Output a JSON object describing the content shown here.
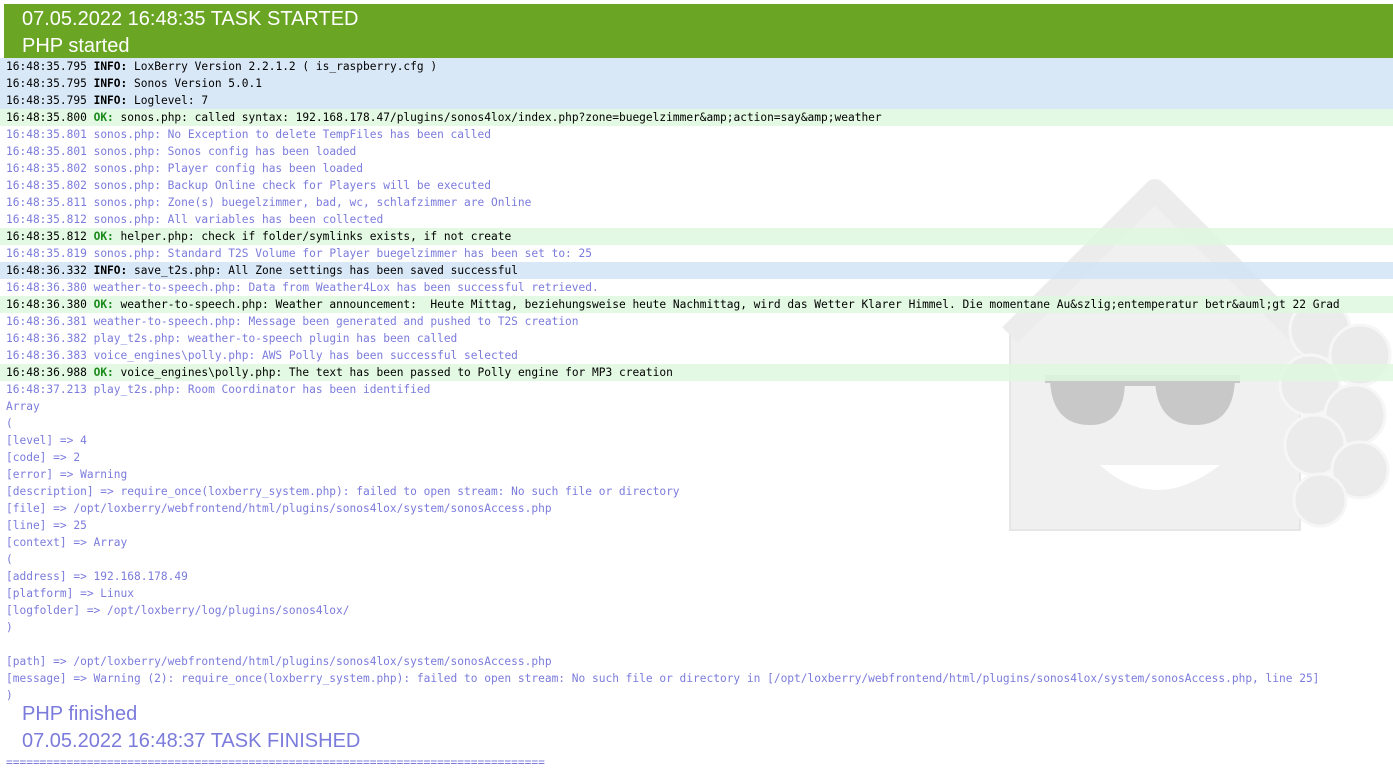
{
  "header": {
    "task_started": "07.05.2022 16:48:35 TASK STARTED",
    "php_started": "PHP started"
  },
  "log_lines": [
    {
      "type": "info",
      "ts": "16:48:35.795",
      "level": "INFO:",
      "msg": "LoxBerry Version 2.2.1.2 ( is_raspberry.cfg )"
    },
    {
      "type": "info",
      "ts": "16:48:35.795",
      "level": "INFO:",
      "msg": "Sonos Version 5.0.1"
    },
    {
      "type": "info",
      "ts": "16:48:35.795",
      "level": "INFO:",
      "msg": "Loglevel: 7"
    },
    {
      "type": "ok",
      "ts": "16:48:35.800",
      "level": "OK:",
      "msg": "sonos.php: called syntax: 192.168.178.47/plugins/sonos4lox/index.php?zone=buegelzimmer&amp;action=say&amp;weather"
    },
    {
      "type": "debug",
      "ts": "16:48:35.801",
      "level": "",
      "msg": "sonos.php: No Exception to delete TempFiles has been called"
    },
    {
      "type": "debug",
      "ts": "16:48:35.801",
      "level": "",
      "msg": "sonos.php: Sonos config has been loaded"
    },
    {
      "type": "debug",
      "ts": "16:48:35.802",
      "level": "",
      "msg": "sonos.php: Player config has been loaded"
    },
    {
      "type": "debug",
      "ts": "16:48:35.802",
      "level": "",
      "msg": "sonos.php: Backup Online check for Players will be executed"
    },
    {
      "type": "debug",
      "ts": "16:48:35.811",
      "level": "",
      "msg": "sonos.php: Zone(s) buegelzimmer, bad, wc, schlafzimmer are Online"
    },
    {
      "type": "debug",
      "ts": "16:48:35.812",
      "level": "",
      "msg": "sonos.php: All variables has been collected"
    },
    {
      "type": "ok",
      "ts": "16:48:35.812",
      "level": "OK:",
      "msg": "helper.php: check if folder/symlinks exists, if not create"
    },
    {
      "type": "debug",
      "ts": "16:48:35.819",
      "level": "",
      "msg": "sonos.php: Standard T2S Volume for Player buegelzimmer has been set to: 25"
    },
    {
      "type": "info",
      "ts": "16:48:36.332",
      "level": "INFO:",
      "msg": "save_t2s.php: All Zone settings has been saved successful"
    },
    {
      "type": "debug",
      "ts": "16:48:36.380",
      "level": "",
      "msg": "weather-to-speech.php: Data from Weather4Lox has been successful retrieved."
    },
    {
      "type": "ok",
      "ts": "16:48:36.380",
      "level": "OK:",
      "msg": "weather-to-speech.php: Weather announcement:  Heute Mittag, beziehungsweise heute Nachmittag, wird das Wetter Klarer Himmel. Die momentane Au&szlig;entemperatur betr&auml;gt 22 Grad"
    },
    {
      "type": "debug",
      "ts": "16:48:36.381",
      "level": "",
      "msg": "weather-to-speech.php: Message been generated and pushed to T2S creation"
    },
    {
      "type": "debug",
      "ts": "16:48:36.382",
      "level": "",
      "msg": "play_t2s.php: weather-to-speech plugin has been called"
    },
    {
      "type": "debug",
      "ts": "16:48:36.383",
      "level": "",
      "msg": "voice_engines\\polly.php: AWS Polly has been successful selected"
    },
    {
      "type": "ok",
      "ts": "16:48:36.988",
      "level": "OK:",
      "msg": "voice_engines\\polly.php: The text has been passed to Polly engine for MP3 creation"
    },
    {
      "type": "debug",
      "ts": "16:48:37.213",
      "level": "",
      "msg": "play_t2s.php: Room Coordinator has been identified"
    },
    {
      "type": "plain",
      "ts": "",
      "level": "",
      "msg": "Array"
    },
    {
      "type": "plain",
      "ts": "",
      "level": "",
      "msg": "("
    },
    {
      "type": "plain",
      "ts": "",
      "level": "",
      "msg": "[level] => 4"
    },
    {
      "type": "plain",
      "ts": "",
      "level": "",
      "msg": "[code] => 2"
    },
    {
      "type": "plain",
      "ts": "",
      "level": "",
      "msg": "[error] => Warning"
    },
    {
      "type": "plain",
      "ts": "",
      "level": "",
      "msg": "[description] => require_once(loxberry_system.php): failed to open stream: No such file or directory"
    },
    {
      "type": "plain",
      "ts": "",
      "level": "",
      "msg": "[file] => /opt/loxberry/webfrontend/html/plugins/sonos4lox/system/sonosAccess.php"
    },
    {
      "type": "plain",
      "ts": "",
      "level": "",
      "msg": "[line] => 25"
    },
    {
      "type": "plain",
      "ts": "",
      "level": "",
      "msg": "[context] => Array"
    },
    {
      "type": "plain",
      "ts": "",
      "level": "",
      "msg": "("
    },
    {
      "type": "plain",
      "ts": "",
      "level": "",
      "msg": "[address] => 192.168.178.49"
    },
    {
      "type": "plain",
      "ts": "",
      "level": "",
      "msg": "[platform] => Linux"
    },
    {
      "type": "plain",
      "ts": "",
      "level": "",
      "msg": "[logfolder] => /opt/loxberry/log/plugins/sonos4lox/"
    },
    {
      "type": "plain",
      "ts": "",
      "level": "",
      "msg": ")"
    },
    {
      "type": "plain",
      "ts": "",
      "level": "",
      "msg": ""
    },
    {
      "type": "plain",
      "ts": "",
      "level": "",
      "msg": "[path] => /opt/loxberry/webfrontend/html/plugins/sonos4lox/system/sonosAccess.php"
    },
    {
      "type": "plain",
      "ts": "",
      "level": "",
      "msg": "[message] => Warning (2): require_once(loxberry_system.php): failed to open stream: No such file or directory in [/opt/loxberry/webfrontend/html/plugins/sonos4lox/system/sonosAccess.php, line 25]"
    },
    {
      "type": "plain",
      "ts": "",
      "level": "",
      "msg": ")"
    }
  ],
  "footer": {
    "php_finished": "PHP finished",
    "task_finished": "07.05.2022 16:48:37 TASK FINISHED",
    "separator": "================================================================================"
  },
  "colors": {
    "header_bg": "#6aa624",
    "info_bg": "#d2e4f6",
    "ok_bg": "#def8de",
    "debug_text": "#7b7bdc",
    "ok_label": "#1a8a1a"
  },
  "icons": {
    "watermark": "loxberry-logo-watermark"
  }
}
